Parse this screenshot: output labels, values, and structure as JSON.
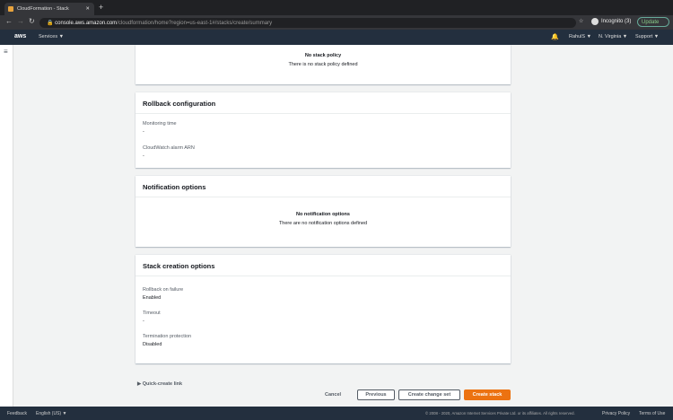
{
  "browser": {
    "tab_title": "CloudFormation - Stack",
    "url_host": "console.aws.amazon.com",
    "url_path": "/cloudformation/home?region=us-east-1#/stacks/create/summary",
    "profile": "Incognito (3)",
    "update": "Update"
  },
  "nav": {
    "logo": "aws",
    "services": "Services ▼",
    "user": "RahulS ▼",
    "region": "N. Virginia ▼",
    "support": "Support ▼"
  },
  "stack_policy": {
    "title": "No stack policy",
    "desc": "There is no stack policy defined"
  },
  "rollback": {
    "title": "Rollback configuration",
    "fields": [
      {
        "label": "Monitoring time",
        "value": "-"
      },
      {
        "label": "CloudWatch alarm ARN",
        "value": "-"
      }
    ]
  },
  "notification": {
    "title": "Notification options",
    "empty_title": "No notification options",
    "empty_desc": "There are no notification options defined"
  },
  "creation": {
    "title": "Stack creation options",
    "fields": [
      {
        "label": "Rollback on failure",
        "value": "Enabled"
      },
      {
        "label": "Timeout",
        "value": "-"
      },
      {
        "label": "Termination protection",
        "value": "Disabled"
      }
    ]
  },
  "quick_create": "Quick-create link",
  "actions": {
    "cancel": "Cancel",
    "previous": "Previous",
    "change_set": "Create change set",
    "create": "Create stack"
  },
  "footer": {
    "feedback": "Feedback",
    "language": "English (US) ▼",
    "copyright": "© 2008 - 2020, Amazon Internet Services Private Ltd. or its affiliates. All rights reserved.",
    "privacy": "Privacy Policy",
    "terms": "Terms of Use"
  }
}
